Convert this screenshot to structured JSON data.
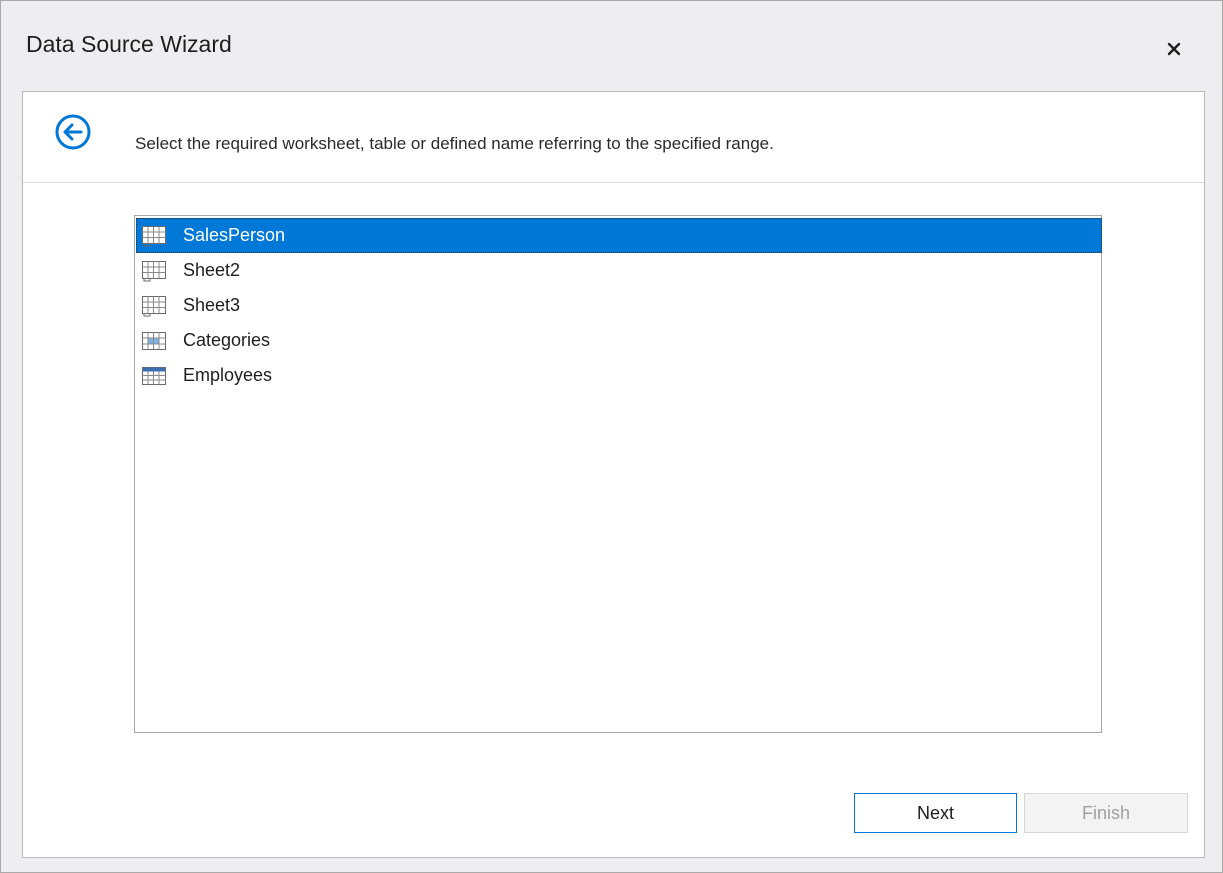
{
  "window": {
    "title": "Data Source Wizard",
    "close_icon": "close-icon"
  },
  "header": {
    "back_icon": "back-arrow-icon",
    "instruction": "Select the required worksheet, table or defined name referring to the specified range."
  },
  "list": {
    "selected_index": 0,
    "items": [
      {
        "label": "SalesPerson",
        "icon": "worksheet-icon"
      },
      {
        "label": "Sheet2",
        "icon": "worksheet-icon"
      },
      {
        "label": "Sheet3",
        "icon": "worksheet-icon"
      },
      {
        "label": "Categories",
        "icon": "defined-name-icon"
      },
      {
        "label": "Employees",
        "icon": "table-icon"
      }
    ]
  },
  "buttons": {
    "next": "Next",
    "finish": "Finish"
  },
  "colors": {
    "accent": "#0078d7",
    "selection_text": "#ffffff",
    "disabled_text": "#a0a0a0"
  }
}
